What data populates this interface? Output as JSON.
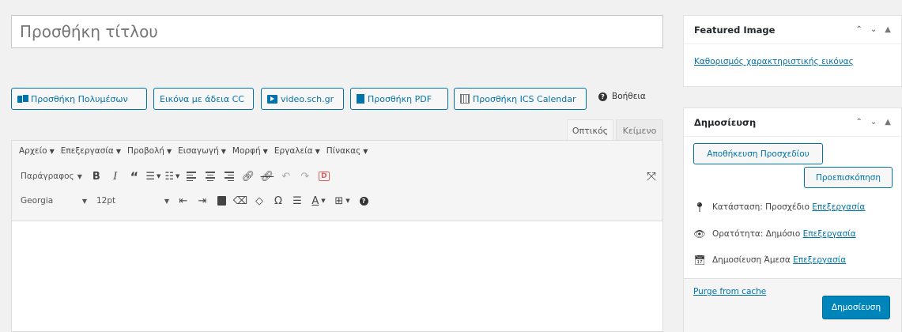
{
  "title": {
    "placeholder": "Προσθήκη τίτλου"
  },
  "media_buttons": {
    "add_media": "Προσθήκη Πολυμέσων",
    "cc_image": "Εικόνα με άδεια CC",
    "video_sch": "video.sch.gr",
    "add_pdf": "Προσθήκη PDF",
    "add_ics": "Προσθήκη ICS Calendar",
    "help": "Βοήθεια"
  },
  "editor_tabs": {
    "visual": "Οπτικός",
    "text": "Κείμενο"
  },
  "menubar": {
    "items": [
      "Αρχείο",
      "Επεξεργασία",
      "Προβολή",
      "Εισαγωγή",
      "Μορφή",
      "Εργαλεία",
      "Πίνακας"
    ]
  },
  "toolbar": {
    "format_select": "Παράγραφος",
    "font_select": "Georgia",
    "size_select": "12pt",
    "bold": "B",
    "italic": "I",
    "quote": "“",
    "omega": "Ω",
    "text_color": "A"
  },
  "featured_image": {
    "title": "Featured Image",
    "set_link": "Καθορισμός χαρακτηριστικής εικόνας"
  },
  "publish": {
    "title": "Δημοσίευση",
    "save_draft": "Αποθήκευση Προσχεδίου",
    "preview": "Προεπισκόπηση",
    "status_label": "Κατάσταση: Προσχέδιο",
    "visibility_label": "Ορατότητα: Δημόσιο",
    "schedule_label": "Δημοσίευση Άμεσα",
    "edit_link": "Επεξεργασία",
    "purge": "Purge from cache",
    "publish_button": "Δημοσίευση"
  },
  "colors": {
    "accent": "#0073aa",
    "primary_button": "#0085ba",
    "background": "#f1f1f1"
  }
}
